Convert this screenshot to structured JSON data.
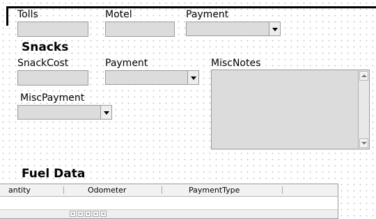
{
  "labels": {
    "tolls": "Tolls",
    "motel": "Motel",
    "payment_top": "Payment",
    "snacks_heading": "Snacks",
    "snack_cost": "SnackCost",
    "payment_snacks": "Payment",
    "misc_notes": "MiscNotes",
    "misc_payment": "MiscPayment",
    "fuel_heading": "Fuel Data"
  },
  "fields": {
    "tolls_value": "",
    "motel_value": "",
    "payment_top_value": "",
    "snack_cost_value": "",
    "payment_snacks_value": "",
    "misc_notes_value": "",
    "misc_payment_value": ""
  },
  "fuel_grid": {
    "columns": [
      "antity",
      "Odometer",
      "PaymentType"
    ]
  },
  "colors": {
    "field_bg": "#dcdcdc",
    "field_border": "#9a9a9a",
    "frame": "#000000"
  },
  "icons": [
    "chevron-down-icon",
    "scroll-up-icon",
    "scroll-down-icon",
    "nav-first-icon",
    "nav-prev-icon",
    "nav-next-icon",
    "nav-last-icon",
    "nav-new-icon"
  ]
}
